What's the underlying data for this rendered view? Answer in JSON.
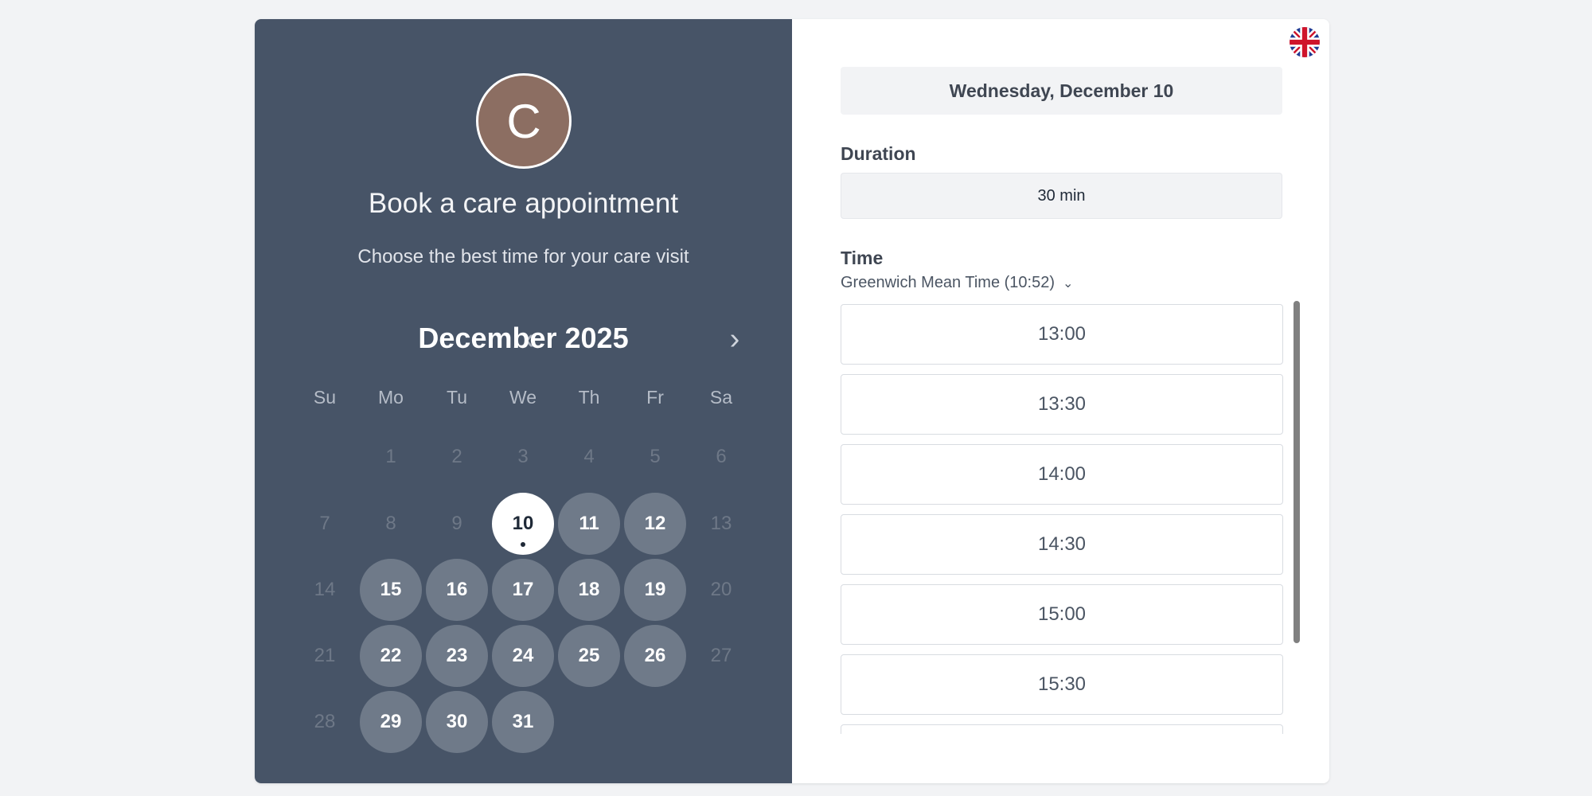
{
  "host": {
    "avatar_initial": "C",
    "avatar_color": "#8c6e62"
  },
  "title": "Book a care appointment",
  "subtitle": "Choose the best time for your care visit",
  "calendar": {
    "month_label": "December 2025",
    "prev_label": "‹",
    "next_label": "›",
    "weekdays": [
      "Su",
      "Mo",
      "Tu",
      "We",
      "Th",
      "Fr",
      "Sa"
    ],
    "weeks": [
      [
        {
          "label": "",
          "state": "empty"
        },
        {
          "label": "1",
          "state": "disabled"
        },
        {
          "label": "2",
          "state": "disabled"
        },
        {
          "label": "3",
          "state": "disabled"
        },
        {
          "label": "4",
          "state": "disabled"
        },
        {
          "label": "5",
          "state": "disabled"
        },
        {
          "label": "6",
          "state": "disabled"
        }
      ],
      [
        {
          "label": "7",
          "state": "disabled"
        },
        {
          "label": "8",
          "state": "disabled"
        },
        {
          "label": "9",
          "state": "disabled"
        },
        {
          "label": "10",
          "state": "selected",
          "today": true
        },
        {
          "label": "11",
          "state": "available"
        },
        {
          "label": "12",
          "state": "available"
        },
        {
          "label": "13",
          "state": "disabled"
        }
      ],
      [
        {
          "label": "14",
          "state": "disabled"
        },
        {
          "label": "15",
          "state": "available"
        },
        {
          "label": "16",
          "state": "available"
        },
        {
          "label": "17",
          "state": "available"
        },
        {
          "label": "18",
          "state": "available"
        },
        {
          "label": "19",
          "state": "available"
        },
        {
          "label": "20",
          "state": "disabled"
        }
      ],
      [
        {
          "label": "21",
          "state": "disabled"
        },
        {
          "label": "22",
          "state": "available"
        },
        {
          "label": "23",
          "state": "available"
        },
        {
          "label": "24",
          "state": "available"
        },
        {
          "label": "25",
          "state": "available"
        },
        {
          "label": "26",
          "state": "available"
        },
        {
          "label": "27",
          "state": "disabled"
        }
      ],
      [
        {
          "label": "28",
          "state": "disabled"
        },
        {
          "label": "29",
          "state": "available"
        },
        {
          "label": "30",
          "state": "available"
        },
        {
          "label": "31",
          "state": "available"
        },
        {
          "label": "",
          "state": "empty"
        },
        {
          "label": "",
          "state": "empty"
        },
        {
          "label": "",
          "state": "empty"
        }
      ]
    ]
  },
  "selected_date_label": "Wednesday, December 10",
  "duration": {
    "label": "Duration",
    "value": "30 min"
  },
  "time": {
    "label": "Time",
    "timezone": "Greenwich Mean Time (10:52)",
    "slots": [
      "13:00",
      "13:30",
      "14:00",
      "14:30",
      "15:00",
      "15:30",
      ""
    ]
  },
  "language_flag": "uk-flag-icon",
  "colors": {
    "left_panel": "#475467",
    "available_day": "#6f7a89",
    "selected_day": "#ffffff"
  }
}
